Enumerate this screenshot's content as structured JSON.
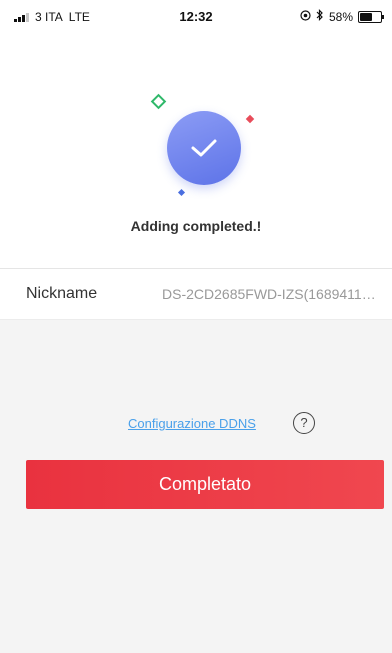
{
  "status_bar": {
    "carrier": "3 ITA",
    "network": "LTE",
    "time": "12:32",
    "battery_text": "58%",
    "battery_level": 0.58,
    "icons": [
      "signal-icon",
      "location-lock-icon",
      "bluetooth-icon",
      "battery-icon"
    ]
  },
  "result": {
    "icon": "check-icon",
    "message": "Adding completed.!"
  },
  "device": {
    "nickname_label": "Nickname",
    "nickname_value": "DS-2CD2685FWD-IZS(1689411…"
  },
  "ddns": {
    "link_label": "Configurazione DDNS",
    "help_glyph": "?"
  },
  "actions": {
    "complete_label": "Completato"
  },
  "colors": {
    "accent_red": "#e9323f",
    "check_blue": "#6b80ee",
    "link_blue": "#4aa0ea",
    "background": "#f4f4f4"
  }
}
